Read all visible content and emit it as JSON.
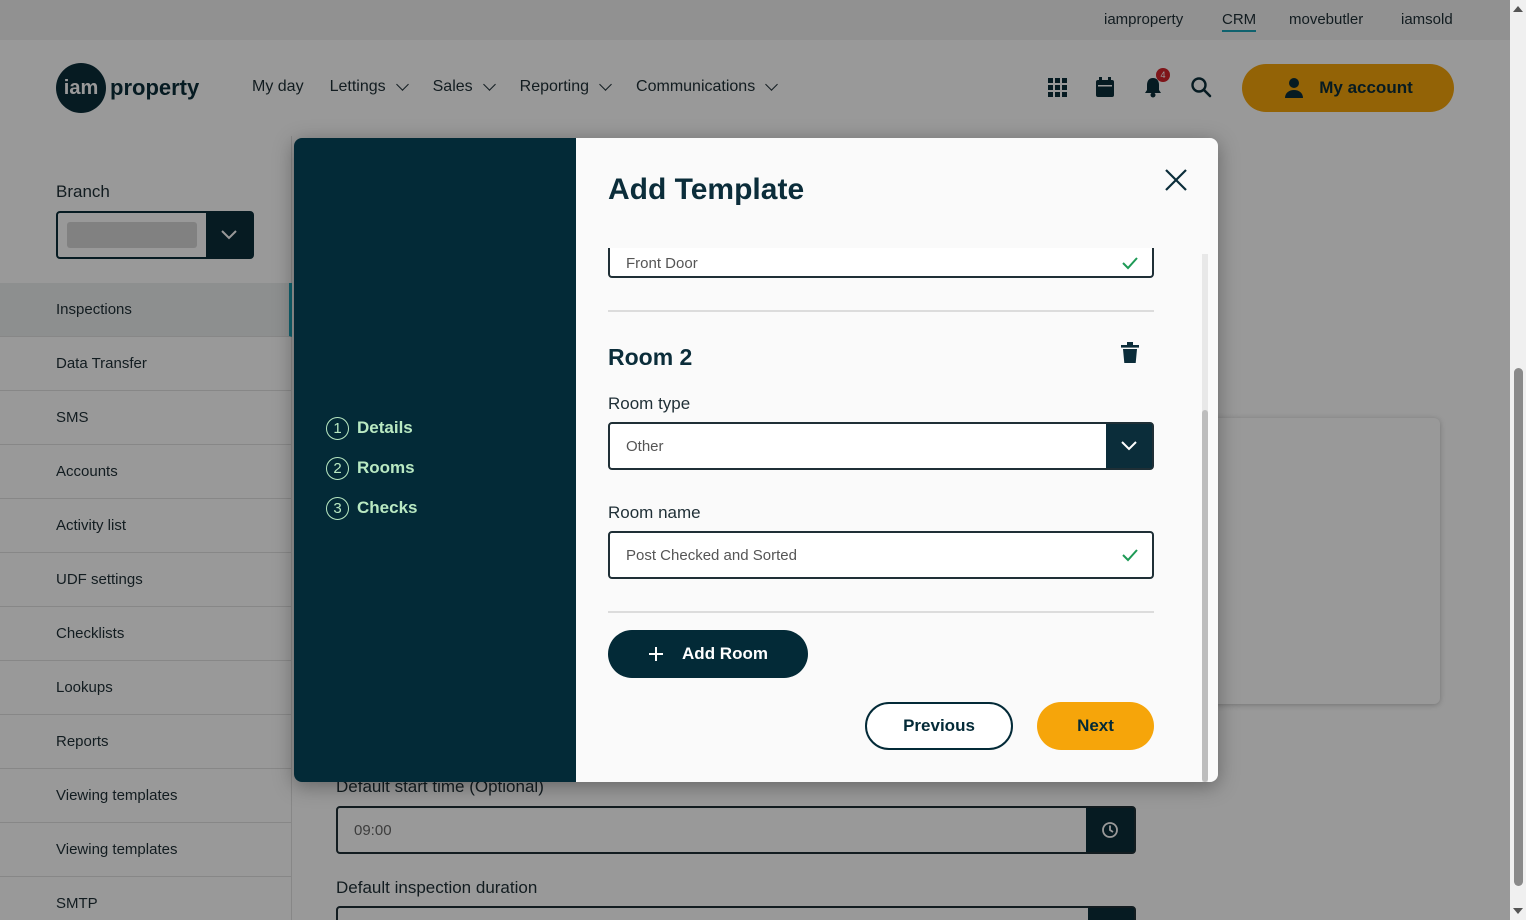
{
  "top_links": [
    "iamproperty",
    "CRM",
    "movebutler",
    "iamsold"
  ],
  "logo": {
    "badge": "iam",
    "word": "property"
  },
  "nav": {
    "items": [
      "My day",
      "Lettings",
      "Sales",
      "Reporting",
      "Communications"
    ],
    "notification_count": "4",
    "account_label": "My account"
  },
  "sidebar": {
    "branch_label": "Branch",
    "items": [
      "Inspections",
      "Data Transfer",
      "SMS",
      "Accounts",
      "Activity list",
      "UDF settings",
      "Checklists",
      "Lookups",
      "Reports",
      "Viewing templates",
      "Viewing templates",
      "SMTP"
    ]
  },
  "settings": {
    "start_time_label": "Default start time (Optional)",
    "start_time_value": "09:00",
    "duration_label": "Default inspection duration"
  },
  "modal": {
    "title": "Add Template",
    "steps": [
      {
        "num": "1",
        "label": "Details"
      },
      {
        "num": "2",
        "label": "Rooms"
      },
      {
        "num": "3",
        "label": "Checks"
      }
    ],
    "previous_room_name": "Front Door",
    "room_heading": "Room 2",
    "room_type_label": "Room type",
    "room_type_value": "Other",
    "room_name_label": "Room name",
    "room_name_value": "Post Checked and Sorted",
    "add_room_label": "Add Room",
    "previous_label": "Previous",
    "next_label": "Next"
  },
  "colors": {
    "brand_dark": "#032a37",
    "accent_yellow": "#f6a50a",
    "step_green": "#b9e9c2",
    "valid_green": "#1e9a56",
    "link_underline": "#19a3b8"
  }
}
